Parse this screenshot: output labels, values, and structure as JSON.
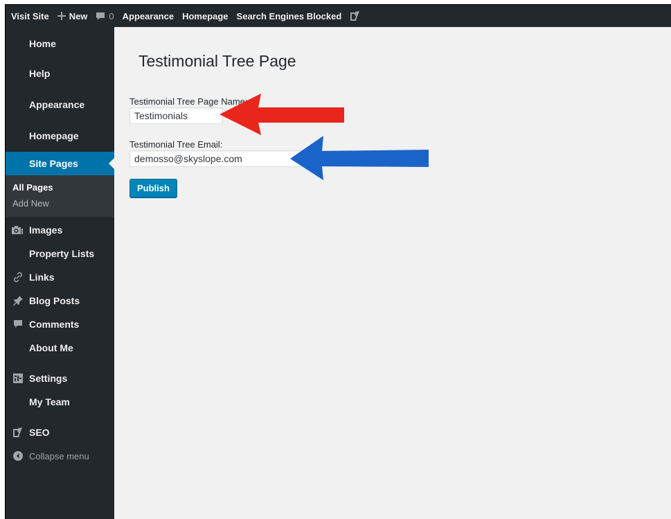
{
  "adminbar": {
    "visit_site": "Visit Site",
    "new_label": "New",
    "comments_count": "0",
    "appearance": "Appearance",
    "homepage": "Homepage",
    "search_engines": "Search Engines Blocked",
    "yoast_icon": "yoast-icon"
  },
  "sidebar": {
    "home": "Home",
    "help": "Help",
    "appearance": "Appearance",
    "homepage": "Homepage",
    "site_pages": "Site Pages",
    "sub_all_pages": "All Pages",
    "sub_add_new": "Add New",
    "images": "Images",
    "property_lists": "Property Lists",
    "links": "Links",
    "blog_posts": "Blog Posts",
    "comments": "Comments",
    "about_me": "About Me",
    "settings": "Settings",
    "my_team": "My Team",
    "seo": "SEO",
    "collapse": "Collapse menu"
  },
  "main": {
    "title": "Testimonial Tree Page",
    "page_name_label": "Testimonial Tree Page Name:",
    "page_name_value": "Testimonials",
    "email_label": "Testimonial Tree Email:",
    "email_value": "demosso@skyslope.com",
    "publish": "Publish"
  },
  "colors": {
    "admin_dark": "#23282d",
    "accent": "#0073aa",
    "red_arrow": "#e8261c",
    "blue_arrow": "#1a63c9"
  }
}
